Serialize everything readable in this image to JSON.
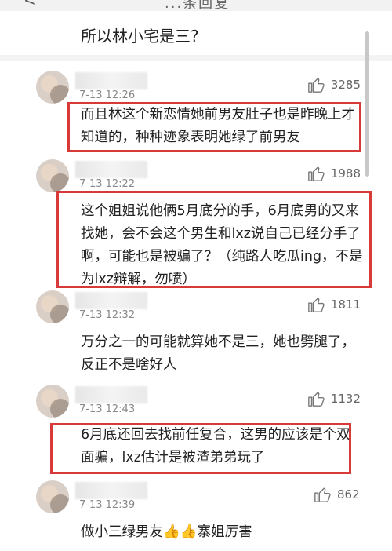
{
  "header": {
    "back_icon": "back-arrow-icon",
    "title": "...条回复"
  },
  "quoted_reply": "所以林小宅是三?",
  "comments": [
    {
      "time": "7-13 12:26",
      "likes": "3285",
      "text": "而且林这个新恋情她前男友肚子也是昨晚上才\n知道的，种种迹象表明她绿了前男友",
      "highlighted": true
    },
    {
      "time": "7-13 12:22",
      "likes": "1988",
      "text": "这个姐姐说他俩5月底分的手，6月底男的又来\n找她，会不会这个男生和lxz说自己已经分手了\n啊，可能也是被骗了？（纯路人吃瓜ing，不是\n为lxz辩解，勿喷）",
      "highlighted": true
    },
    {
      "time": "7-13 12:32",
      "likes": "1811",
      "text": "万分之一的可能就算她不是三，她也劈腿了，\n反正不是啥好人",
      "highlighted": false
    },
    {
      "time": "7-13 12:43",
      "likes": "1132",
      "text": "6月底还回去找前任复合，这男的应该是个双\n面骗，lxz估计是被渣弟弟玩了",
      "highlighted": true
    },
    {
      "time": "7-13 12:39",
      "likes": "862",
      "text": "做小三绿男友👍👍寨姐厉害",
      "highlighted": false
    }
  ],
  "colors": {
    "highlight_border": "#d83a3a",
    "meta_text": "#888888"
  }
}
